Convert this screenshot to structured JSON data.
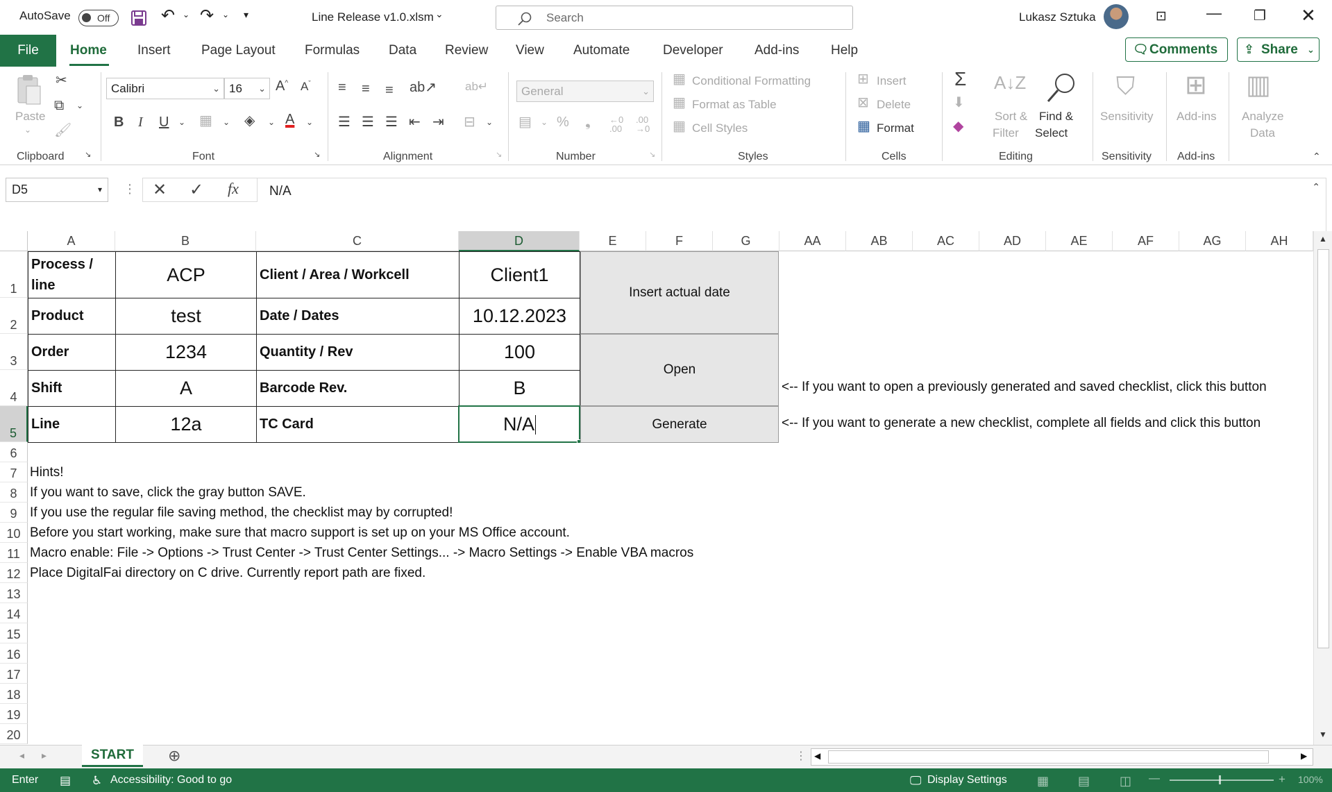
{
  "titlebar": {
    "autosave_label": "AutoSave",
    "autosave_state": "Off",
    "filename": "Line Release v1.0.xlsm",
    "search_placeholder": "Search",
    "user_name": "Lukasz Sztuka"
  },
  "tabs": [
    "File",
    "Home",
    "Insert",
    "Page Layout",
    "Formulas",
    "Data",
    "Review",
    "View",
    "Automate",
    "Developer",
    "Add-ins",
    "Help"
  ],
  "tab_buttons": {
    "comments": "Comments",
    "share": "Share"
  },
  "ribbon": {
    "clipboard": {
      "label": "Clipboard",
      "paste": "Paste"
    },
    "font": {
      "label": "Font",
      "name": "Calibri",
      "size": "16"
    },
    "alignment": {
      "label": "Alignment"
    },
    "number": {
      "label": "Number",
      "format": "General"
    },
    "styles": {
      "label": "Styles",
      "conditional": "Conditional Formatting",
      "format_table": "Format as Table",
      "cell_styles": "Cell Styles"
    },
    "cells": {
      "label": "Cells",
      "insert": "Insert",
      "delete": "Delete",
      "format": "Format"
    },
    "editing": {
      "label": "Editing",
      "sort_filter_1": "Sort &",
      "sort_filter_2": "Filter",
      "find_select_1": "Find &",
      "find_select_2": "Select"
    },
    "sensitivity": {
      "label": "Sensitivity",
      "button": "Sensitivity"
    },
    "addins": {
      "label": "Add-ins",
      "button": "Add-ins"
    },
    "analyze": {
      "line1": "Analyze",
      "line2": "Data"
    }
  },
  "formula_bar": {
    "name_box": "D5",
    "formula": "N/A"
  },
  "columns": [
    "A",
    "B",
    "C",
    "D",
    "E",
    "F",
    "G",
    "AA",
    "AB",
    "AC",
    "AD",
    "AE",
    "AF",
    "AG",
    "AH"
  ],
  "rows": [
    "1",
    "2",
    "3",
    "4",
    "5",
    "6",
    "7",
    "8",
    "9",
    "10",
    "11",
    "12",
    "13",
    "14",
    "15",
    "16",
    "17",
    "18",
    "19",
    "20"
  ],
  "form": {
    "a1": "Process / line",
    "b1": "ACP",
    "c1": "Client / Area / Workcell",
    "d1": "Client1",
    "a2": "Product",
    "b2": "test",
    "c2": "Date / Dates",
    "d2": "10.12.2023",
    "a3": "Order",
    "b3": "1234",
    "c3": "Quantity / Rev",
    "d3": "100",
    "a4": "Shift",
    "b4": "A",
    "c4": "Barcode Rev.",
    "d4": "B",
    "a5": "Line",
    "b5": "12a",
    "c5": "TC Card",
    "d5": "N/A"
  },
  "buttons": {
    "insert_date": "Insert actual date",
    "open": "Open",
    "generate": "Generate"
  },
  "notes": {
    "open": "<-- If you want to open a previously generated and saved checklist, click this button",
    "generate": "<-- If you want to generate a new checklist, complete all fields and click this button"
  },
  "hints": [
    "Hints!",
    "If you want to save, click the gray button SAVE.",
    "If you use the regular file saving method, the checklist may by corrupted!",
    "Before you start working, make sure that macro support is set up on your MS Office account.",
    "Macro enable: File -> Options -> Trust Center -> Trust Center Settings... -> Macro Settings -> Enable VBA macros",
    "Place DigitalFai directory on C drive. Currently report path are fixed."
  ],
  "sheet_tab": "START",
  "status": {
    "mode": "Enter",
    "accessibility": "Accessibility: Good to go",
    "display_settings": "Display Settings",
    "zoom": "100%"
  },
  "colors": {
    "accent": "#217346"
  }
}
